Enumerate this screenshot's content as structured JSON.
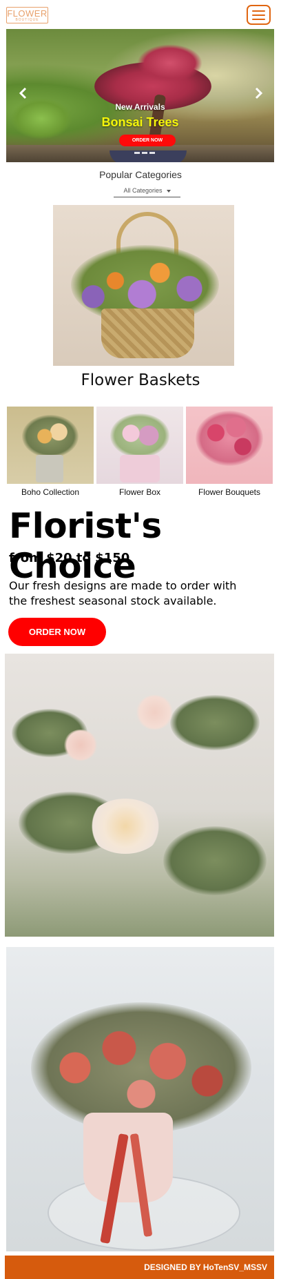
{
  "header": {
    "logo_main": "FLOWER",
    "logo_sub": "BOUTIQUE",
    "menu_icon": "hamburger-menu-icon",
    "accent_color": "#e06510"
  },
  "hero": {
    "subtitle": "New Arrivals",
    "title": "Bonsai Trees",
    "button_label": "ORDER NOW",
    "prev_icon": "chevron-left-icon",
    "next_icon": "chevron-right-icon",
    "slides_count": 3,
    "title_color": "#f5f50a",
    "button_color": "#ff0a0a"
  },
  "categories": {
    "heading": "Popular Categories",
    "selected": "All Categories",
    "featured_title": "Flower Baskets",
    "tiles": [
      {
        "label": "Boho Collection"
      },
      {
        "label": "Flower Box"
      },
      {
        "label": "Flower Bouquets"
      }
    ]
  },
  "florist": {
    "title": "Florist's Choice",
    "price": "from $20 to $150",
    "description": "Our fresh designs are made to order with the freshest seasonal stock available.",
    "button_label": "ORDER NOW",
    "button_color": "#ff0000"
  },
  "footer": {
    "text": "DESIGNED BY HoTenSV_MSSV",
    "color": "#d65b0d"
  }
}
